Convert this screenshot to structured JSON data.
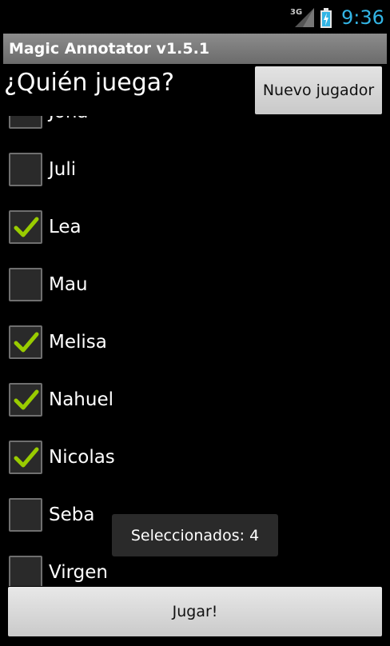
{
  "status_bar": {
    "network": "3G",
    "time": "9:36",
    "time_color": "#33b5e5",
    "signal_icon": "signal-icon",
    "battery_icon": "battery-charging-icon"
  },
  "app": {
    "title": "Magic Annotator v1.5.1"
  },
  "header": {
    "question": "¿Quién juega?",
    "new_player_label": "Nuevo jugador"
  },
  "players": [
    {
      "name": "Joña",
      "checked": false
    },
    {
      "name": "Juli",
      "checked": false
    },
    {
      "name": "Lea",
      "checked": true
    },
    {
      "name": "Mau",
      "checked": false
    },
    {
      "name": "Melisa",
      "checked": true
    },
    {
      "name": "Nahuel",
      "checked": true
    },
    {
      "name": "Nicolas",
      "checked": true
    },
    {
      "name": "Seba",
      "checked": false
    },
    {
      "name": "Virgen",
      "checked": false
    }
  ],
  "toast": {
    "text": "Seleccionados: 4"
  },
  "footer": {
    "play_label": "Jugar!"
  },
  "colors": {
    "check_green": "#99cc00",
    "accent_blue": "#33b5e5"
  }
}
